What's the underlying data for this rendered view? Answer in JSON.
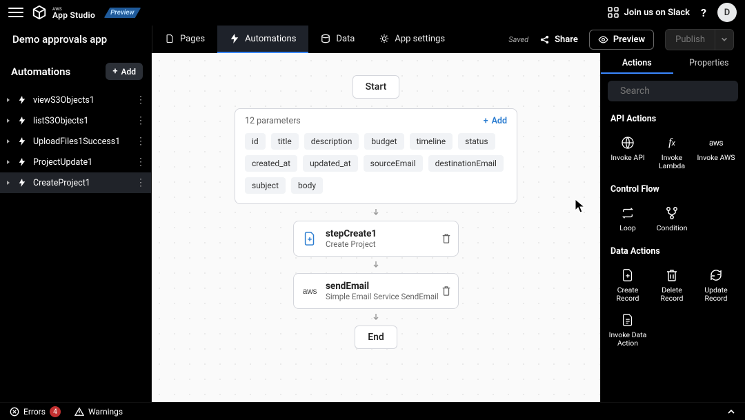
{
  "header": {
    "product_small": "AWS",
    "product_big": "App Studio",
    "preview_label": "Preview",
    "join_slack": "Join us on Slack",
    "help": "?",
    "avatar_initial": "D"
  },
  "app_title": "Demo approvals app",
  "nav_tabs": [
    "Pages",
    "Automations",
    "Data",
    "App settings"
  ],
  "nav_active_index": 1,
  "saved_label": "Saved",
  "share_label": "Share",
  "preview_btn": "Preview",
  "publish_btn": "Publish",
  "left": {
    "title": "Automations",
    "add_label": "Add",
    "items": [
      "viewS3Objects1",
      "listS3Objects1",
      "UploadFiles1Success1",
      "ProjectUpdate1",
      "CreateProject1"
    ],
    "active_index": 4
  },
  "canvas": {
    "start": "Start",
    "end": "End",
    "param_count_label": "12 parameters",
    "param_add": "Add",
    "parameters": [
      "id",
      "title",
      "description",
      "budget",
      "timeline",
      "status",
      "created_at",
      "updated_at",
      "sourceEmail",
      "destinationEmail",
      "subject",
      "body"
    ],
    "steps": [
      {
        "icon": "file-plus",
        "title": "stepCreate1",
        "subtitle": "Create Project"
      },
      {
        "icon": "aws-text",
        "title": "sendEmail",
        "subtitle": "Simple Email Service SendEmail"
      }
    ]
  },
  "right": {
    "tabs": [
      "Actions",
      "Properties"
    ],
    "active_tab": 0,
    "search_placeholder": "Search",
    "sections": [
      {
        "title": "API Actions",
        "items": [
          {
            "icon": "globe",
            "label": "Invoke API"
          },
          {
            "icon": "fx",
            "label": "Invoke Lambda"
          },
          {
            "icon": "aws",
            "label": "Invoke AWS"
          }
        ]
      },
      {
        "title": "Control Flow",
        "items": [
          {
            "icon": "loop",
            "label": "Loop"
          },
          {
            "icon": "branch",
            "label": "Condition"
          }
        ]
      },
      {
        "title": "Data Actions",
        "items": [
          {
            "icon": "file-plus",
            "label": "Create Record"
          },
          {
            "icon": "trash",
            "label": "Delete Record"
          },
          {
            "icon": "refresh",
            "label": "Update Record"
          },
          {
            "icon": "file-list",
            "label": "Invoke Data Action"
          }
        ]
      }
    ]
  },
  "bottom": {
    "errors_label": "Errors",
    "errors_count": "4",
    "warnings_label": "Warnings"
  }
}
